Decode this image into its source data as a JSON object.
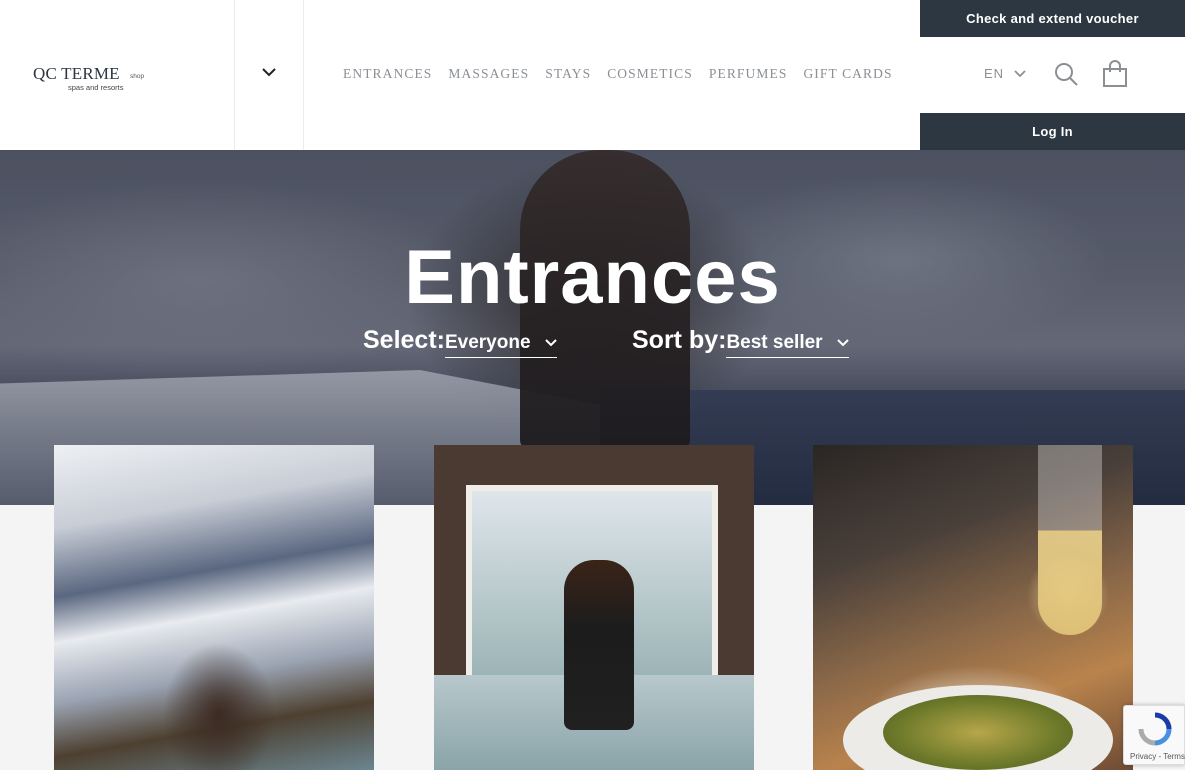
{
  "header": {
    "logo_main": "QC TERME",
    "logo_shop": "shop",
    "logo_sub": "spas and resorts",
    "nav": [
      {
        "label": "ENTRANCES"
      },
      {
        "label": "MASSAGES"
      },
      {
        "label": "STAYS"
      },
      {
        "label": "COSMETICS"
      },
      {
        "label": "PERFUMES"
      },
      {
        "label": "GIFT CARDS"
      }
    ],
    "voucher_label": "Check and extend voucher",
    "login_label": "Log In",
    "language": "EN",
    "icons": {
      "search": "search-icon",
      "cart": "shopping-bag-icon",
      "site_dropdown": "chevron-down-icon"
    }
  },
  "hero": {
    "title": "Entrances",
    "select_label": "Select:",
    "select_value": "Everyone",
    "sort_label": "Sort by:",
    "sort_value": "Best seller"
  },
  "recaptcha": {
    "text": "Privacy - Terms"
  },
  "colors": {
    "dark_button": "#2d3741",
    "nav_text": "#8b8f94",
    "page_background": "#f4f4f4"
  }
}
